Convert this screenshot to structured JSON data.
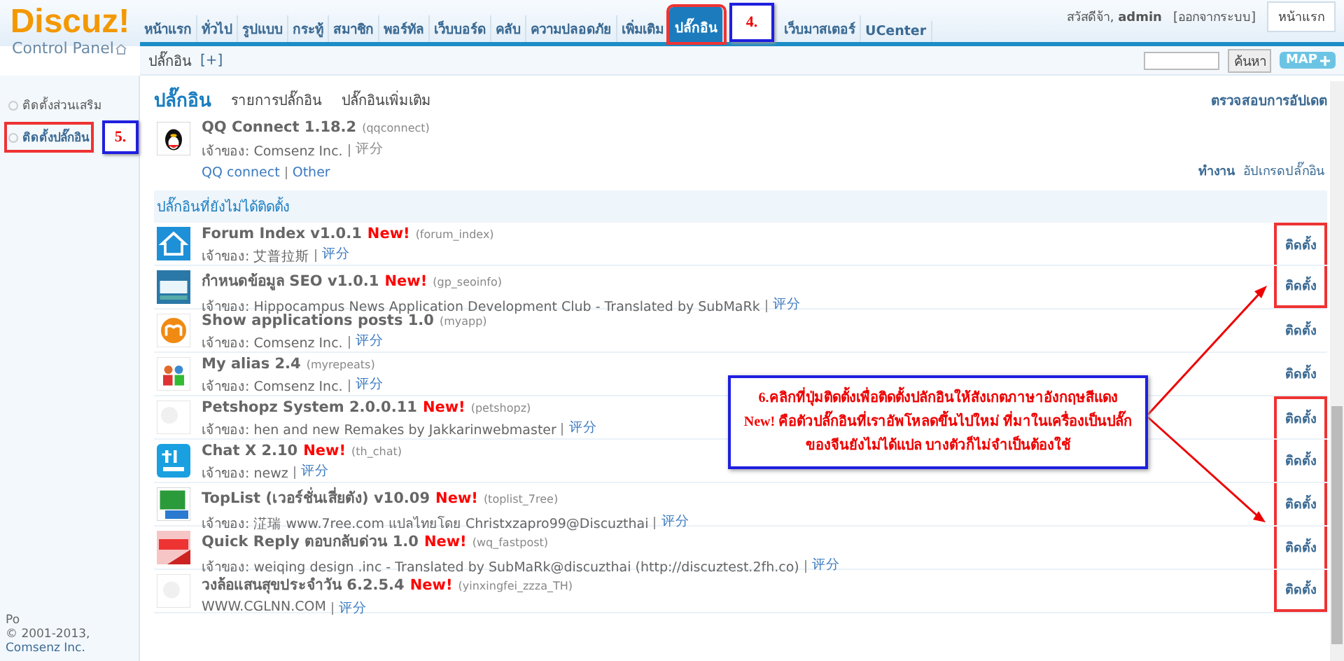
{
  "logo": {
    "title": "Discuz!",
    "subtitle": "Control Panel"
  },
  "nav": [
    {
      "label": "หน้าแรก",
      "selected": false,
      "highlighted": false
    },
    {
      "label": "ทั่วไป",
      "selected": false,
      "highlighted": false
    },
    {
      "label": "รูปแบบ",
      "selected": false,
      "highlighted": false
    },
    {
      "label": "กระทู้",
      "selected": false,
      "highlighted": false
    },
    {
      "label": "สมาชิก",
      "selected": false,
      "highlighted": false
    },
    {
      "label": "พอร์ทัล",
      "selected": false,
      "highlighted": false
    },
    {
      "label": "เว็บบอร์ด",
      "selected": false,
      "highlighted": false
    },
    {
      "label": "คลับ",
      "selected": false,
      "highlighted": false
    },
    {
      "label": "ความปลอดภัย",
      "selected": false,
      "highlighted": false
    },
    {
      "label": "เพิ่มเติม",
      "selected": false,
      "highlighted": false
    },
    {
      "label": "ปลั๊กอิน",
      "selected": true,
      "highlighted": true
    },
    {
      "label": "เว็บมาสเตอร์",
      "selected": false,
      "highlighted": false
    },
    {
      "label": "UCenter",
      "selected": false,
      "highlighted": false
    }
  ],
  "user": {
    "greeting": "สวัสดีจ้า, **admin**",
    "logout": "[ออกจากระบบ]",
    "home_button": "หน้าแรก"
  },
  "subbar": {
    "crumb": "ปลั๊กอิน",
    "add": "[+]",
    "search_button": "ค้นหา",
    "map_button": "MAP"
  },
  "sidebar": {
    "items": [
      {
        "label": "ติดตั้งส่วนเสริม",
        "selected": false,
        "highlighted": false
      },
      {
        "label": "ติดตั้งปลั๊กอิน",
        "selected": true,
        "highlighted": true
      }
    ],
    "footer": {
      "powered": "Po",
      "copyright": "© 2001-2013,",
      "company": "Comsenz Inc."
    }
  },
  "main": {
    "title": "ปลั๊กอิน",
    "links": [
      "รายการปลั๊กอิน",
      "ปลั๊กอินเพิ่มเติม"
    ],
    "check_update": "ตรวจสอบการอัปเดต",
    "installed": [
      {
        "name": "QQ Connect 1.18.2",
        "id": "(qqconnect)",
        "owner_label": "เจ้าของ:",
        "owner": "Comsenz Inc.",
        "rate": "评分",
        "links": [
          "QQ connect",
          "Other"
        ],
        "actions": [
          "ทำงาน",
          "อัปเกรดปลั๊กอิน"
        ]
      }
    ],
    "uninstalled_title": "ปลั๊กอินที่ยังไม่ได้ติดตั้ง",
    "uninstalled": [
      {
        "name": "Forum Index v1.0.1",
        "badge": "New!",
        "id": "(forum_index)",
        "owner_label": "เจ้าของ:",
        "owner": "艾普拉斯",
        "rate": "评分",
        "install": "ติดตั้ง",
        "highlighted": true
      },
      {
        "name": "กำหนดข้อมูล SEO v1.0.1",
        "badge": "New!",
        "id": "(gp_seoinfo)",
        "owner_label": "เจ้าของ:",
        "owner": "Hippocampus News Application Development Club - Translated by SubMaRk",
        "rate": "评分",
        "install": "ติดตั้ง",
        "highlighted": true
      },
      {
        "name": "Show applications posts 1.0",
        "id": "(myapp)",
        "owner_label": "เจ้าของ:",
        "owner": "Comsenz Inc.",
        "rate": "评分",
        "install": "ติดตั้ง",
        "highlighted": false
      },
      {
        "name": "My alias 2.4",
        "id": "(myrepeats)",
        "owner_label": "เจ้าของ:",
        "owner": "Comsenz Inc.",
        "rate": "评分",
        "install": "ติดตั้ง",
        "highlighted": false
      },
      {
        "name": "Petshopz System 2.0.0.11",
        "badge": "New!",
        "id": "(petshopz)",
        "owner_label": "เจ้าของ:",
        "owner": "hen and new Remakes by Jakkarinwebmaster",
        "rate": "评分",
        "install": "ติดตั้ง",
        "highlighted": true
      },
      {
        "name": "Chat X 2.10",
        "badge": "New!",
        "id": "(th_chat)",
        "owner_label": "เจ้าของ:",
        "owner": "newz",
        "rate": "评分",
        "install": "ติดตั้ง",
        "highlighted": true
      },
      {
        "name": "TopList (เวอร์ชั่นเสี่ยตัง) v10.09",
        "badge": "New!",
        "id": "(toplist_7ree)",
        "owner_label": "เจ้าของ:",
        "owner": "淽瑞 www.7ree.com แปลไทยโดย Christxzapro99@Discuzthai",
        "rate": "评分",
        "install": "ติดตั้ง",
        "highlighted": true
      },
      {
        "name": "Quick Reply ตอบกลับด่วน 1.0",
        "badge": "New!",
        "id": "(wq_fastpost)",
        "owner_label": "เจ้าของ:",
        "owner": "weiqing design .inc - Translated by SubMaRk@discuzthai (http://discuztest.2fh.co)",
        "rate": "评分",
        "install": "ติดตั้ง",
        "highlighted": true
      },
      {
        "name": "วงล้อแสนสุขประจำวัน 6.2.5.4",
        "badge": "New!",
        "id": "(yinxingfei_zzza_TH)",
        "owner": "WWW.CGLNN.COM",
        "rate": "评分",
        "install": "ติดตั้ง",
        "highlighted": true
      }
    ]
  },
  "annotations": {
    "step_tab": "4.",
    "step_sidebar": "5.",
    "callout": "6.คลิกที่ปุ่มติดตั้งเพื่อติดตั้งปลักอินให้สังเกตภาษาอังกฤษสีแดง New! คือตัวปลั๊กอินที่เราอัพโหลดขึ้นไปใหม่ ที่มาในเครื่องเป็นปลั๊กของจีนยังไม่ได้แปล บางตัวก็ไม่จำเป็นต้องใช้"
  }
}
